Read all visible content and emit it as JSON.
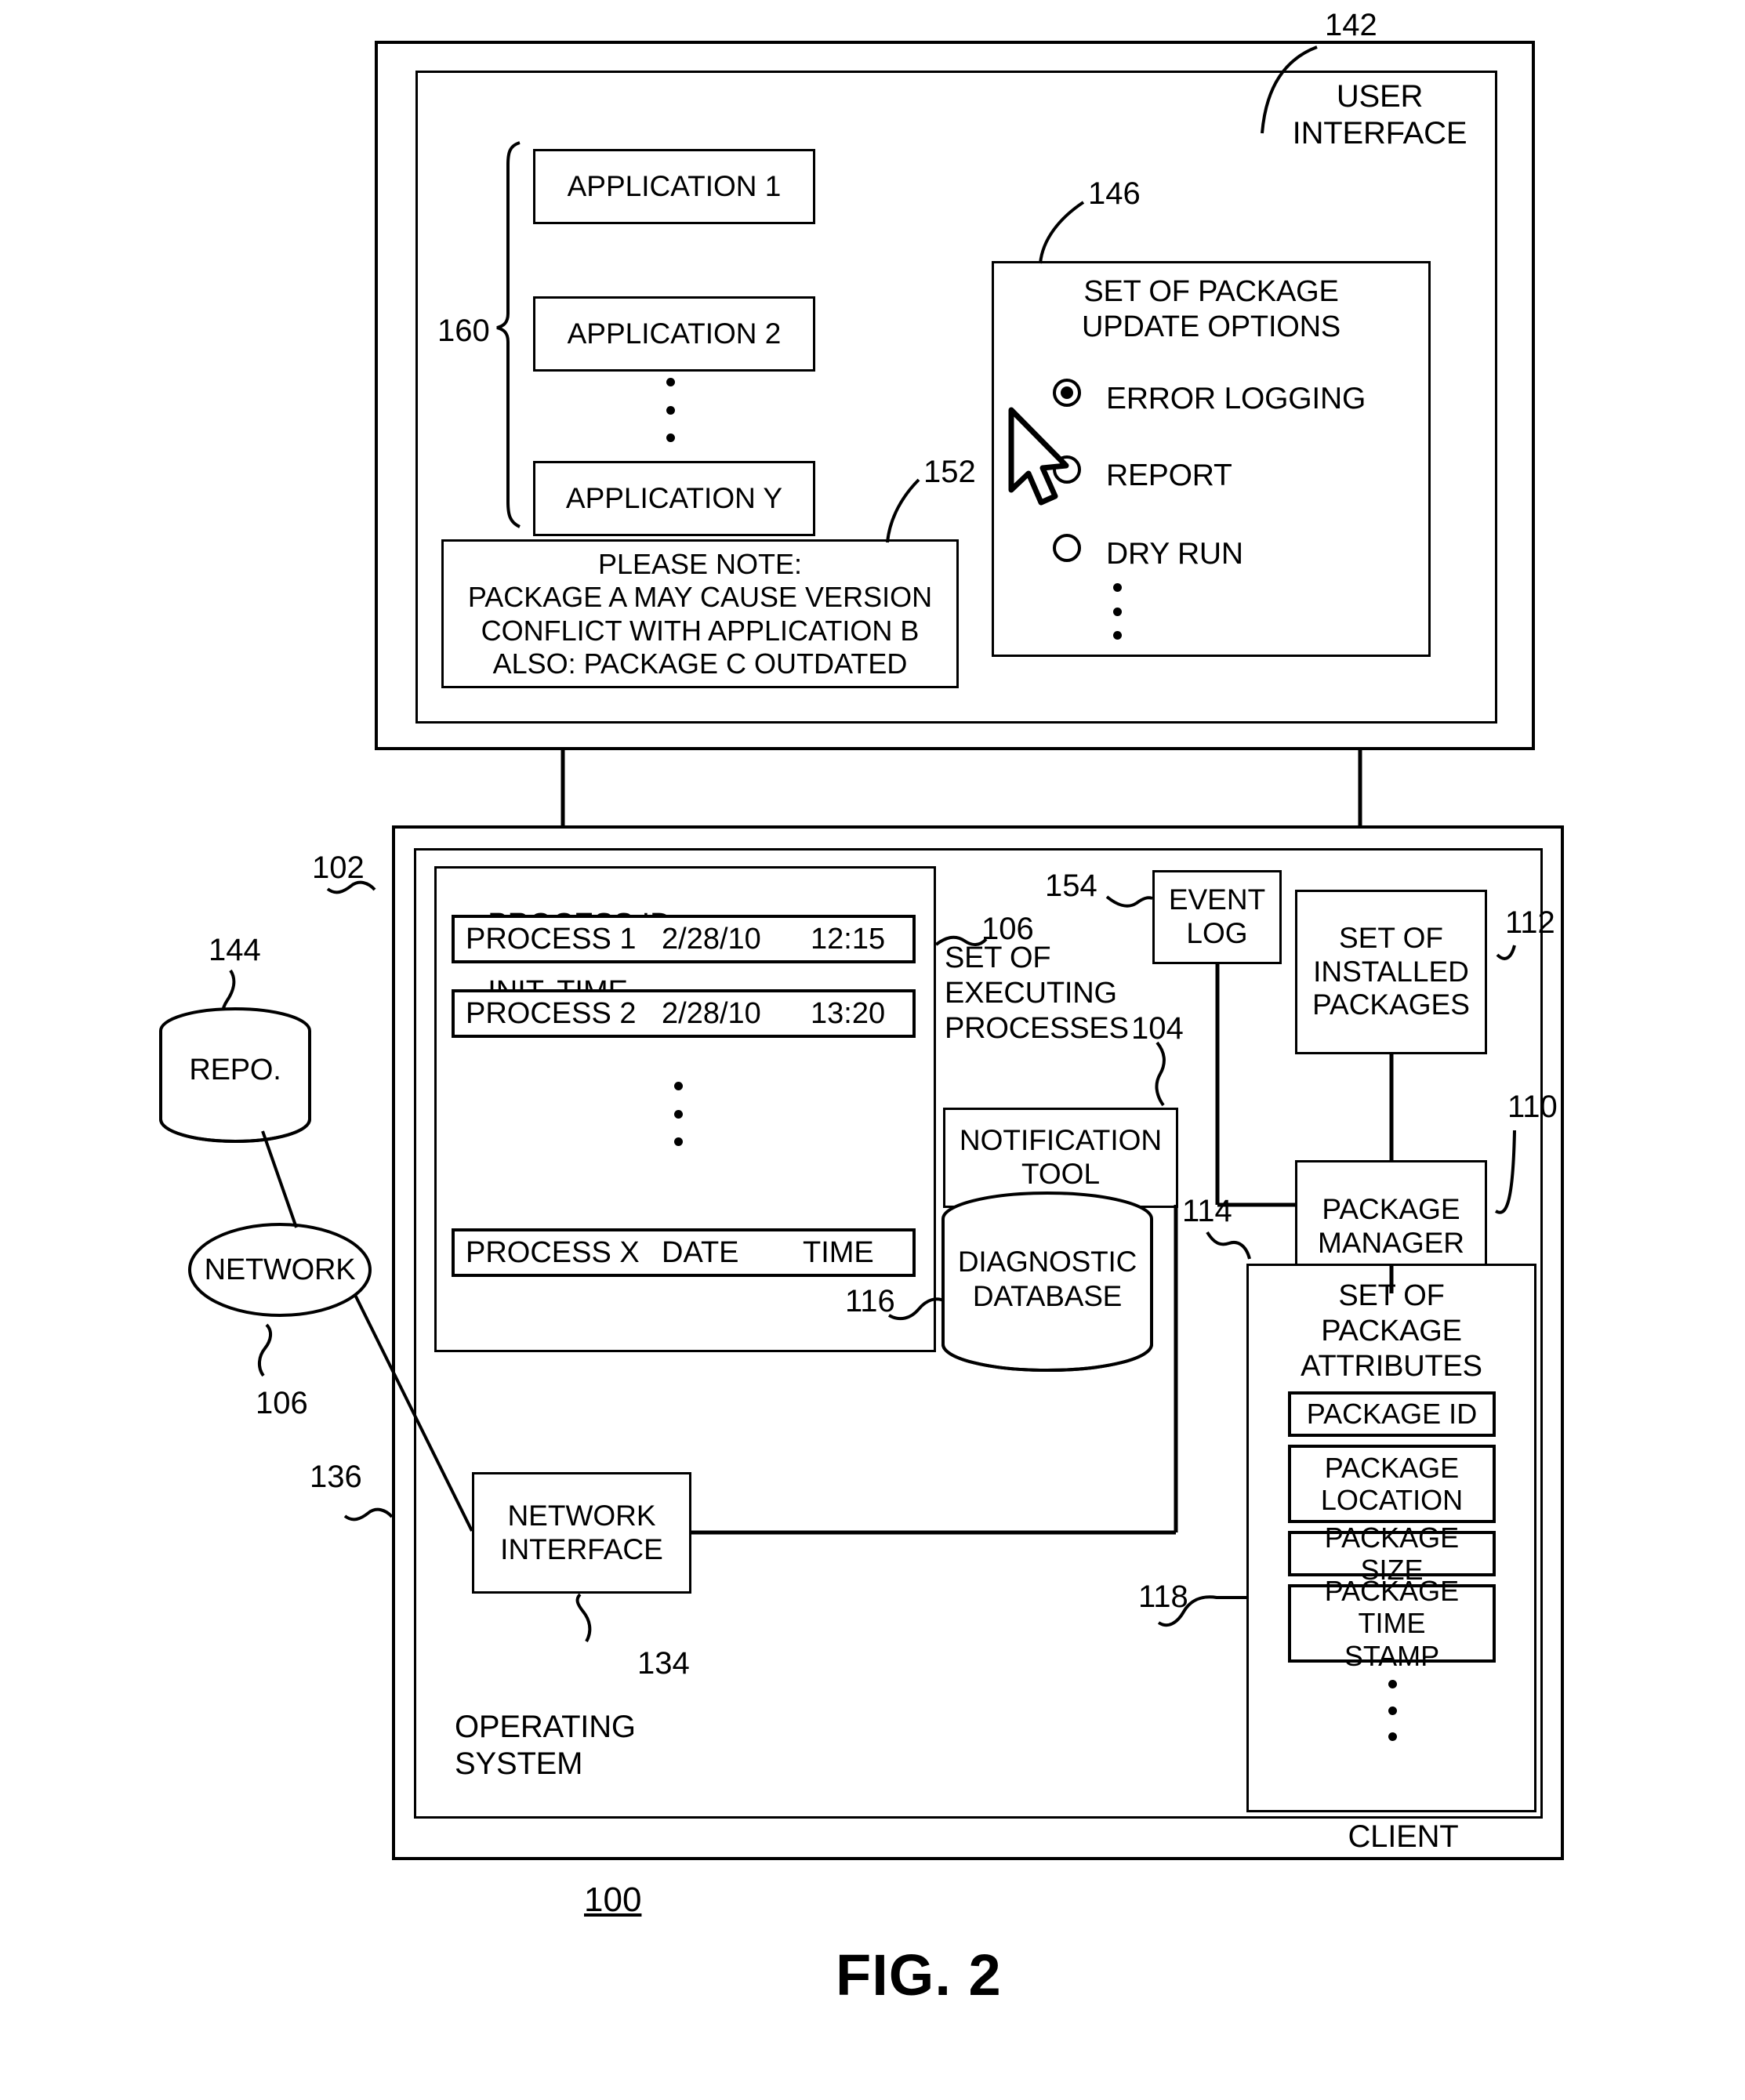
{
  "figure": {
    "caption": "FIG. 2",
    "system_ref": "100"
  },
  "user_interface_panel": {
    "ref_outer": "142",
    "title": "USER\nINTERFACE",
    "applications": {
      "ref": "160",
      "items": [
        {
          "label": "APPLICATION 1"
        },
        {
          "label": "APPLICATION 2"
        },
        {
          "label": "APPLICATION Y"
        }
      ],
      "ellipsis": "vertical-dots"
    },
    "note": {
      "ref": "152",
      "lines": [
        "PLEASE NOTE:",
        "PACKAGE A MAY CAUSE VERSION",
        "CONFLICT WITH APPLICATION B",
        "ALSO: PACKAGE C OUTDATED"
      ]
    },
    "update_options": {
      "ref": "146",
      "title": "SET OF PACKAGE\nUPDATE OPTIONS",
      "options": [
        {
          "label": "ERROR LOGGING",
          "selected": true
        },
        {
          "label": "REPORT",
          "selected": false
        },
        {
          "label": "DRY RUN",
          "selected": false
        }
      ],
      "ellipsis": "vertical-dots",
      "cursor": "mouse-pointer"
    }
  },
  "client_panel": {
    "ref_os": "102",
    "ref_client_border": "136",
    "os_label": "OPERATING\nSYSTEM",
    "client_label": "CLIENT",
    "executing_processes": {
      "ref": "106",
      "label": "SET OF\nEXECUTING\nPROCESSES",
      "columns": [
        "PROCESS ID",
        "INIT. TIME"
      ],
      "rows": [
        {
          "id": "PROCESS 1",
          "date": "2/28/10",
          "time": "12:15"
        },
        {
          "id": "PROCESS 2",
          "date": "2/28/10",
          "time": "13:20"
        },
        {
          "id": "PROCESS X",
          "date": "DATE",
          "time": "TIME"
        }
      ],
      "ellipsis": "vertical-dots"
    },
    "notification_tool": {
      "ref": "104",
      "label": "NOTIFICATION\nTOOL"
    },
    "event_log": {
      "ref": "154",
      "label": "EVENT\nLOG"
    },
    "installed_packages": {
      "ref": "112",
      "label": "SET OF\nINSTALLED\nPACKAGES"
    },
    "package_manager": {
      "ref": "110",
      "label": "PACKAGE\nMANAGER"
    },
    "diagnostic_database": {
      "ref": "116",
      "label": "DIAGNOSTIC\nDATABASE"
    },
    "network_interface": {
      "ref": "134",
      "label": "NETWORK\nINTERFACE"
    },
    "package_attributes": {
      "ref": "114",
      "title": "SET OF\nPACKAGE\nATTRIBUTES",
      "item_ref": "118",
      "items": [
        {
          "label": "PACKAGE ID"
        },
        {
          "label": "PACKAGE\nLOCATION"
        },
        {
          "label": "PACKAGE SIZE"
        },
        {
          "label": "PACKAGE TIME\nSTAMP"
        }
      ],
      "ellipsis": "vertical-dots"
    }
  },
  "external": {
    "repository": {
      "ref": "144",
      "label": "REPO."
    },
    "network": {
      "ref": "106",
      "label": "NETWORK"
    }
  }
}
